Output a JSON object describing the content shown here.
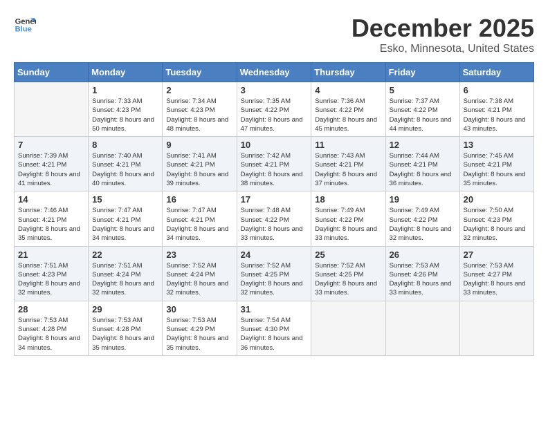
{
  "logo": {
    "line1": "General",
    "line2": "Blue"
  },
  "title": "December 2025",
  "location": "Esko, Minnesota, United States",
  "weekdays": [
    "Sunday",
    "Monday",
    "Tuesday",
    "Wednesday",
    "Thursday",
    "Friday",
    "Saturday"
  ],
  "weeks": [
    [
      {
        "day": "",
        "sunrise": "",
        "sunset": "",
        "daylight": ""
      },
      {
        "day": "1",
        "sunrise": "Sunrise: 7:33 AM",
        "sunset": "Sunset: 4:23 PM",
        "daylight": "Daylight: 8 hours and 50 minutes."
      },
      {
        "day": "2",
        "sunrise": "Sunrise: 7:34 AM",
        "sunset": "Sunset: 4:23 PM",
        "daylight": "Daylight: 8 hours and 48 minutes."
      },
      {
        "day": "3",
        "sunrise": "Sunrise: 7:35 AM",
        "sunset": "Sunset: 4:22 PM",
        "daylight": "Daylight: 8 hours and 47 minutes."
      },
      {
        "day": "4",
        "sunrise": "Sunrise: 7:36 AM",
        "sunset": "Sunset: 4:22 PM",
        "daylight": "Daylight: 8 hours and 45 minutes."
      },
      {
        "day": "5",
        "sunrise": "Sunrise: 7:37 AM",
        "sunset": "Sunset: 4:22 PM",
        "daylight": "Daylight: 8 hours and 44 minutes."
      },
      {
        "day": "6",
        "sunrise": "Sunrise: 7:38 AM",
        "sunset": "Sunset: 4:21 PM",
        "daylight": "Daylight: 8 hours and 43 minutes."
      }
    ],
    [
      {
        "day": "7",
        "sunrise": "Sunrise: 7:39 AM",
        "sunset": "Sunset: 4:21 PM",
        "daylight": "Daylight: 8 hours and 41 minutes."
      },
      {
        "day": "8",
        "sunrise": "Sunrise: 7:40 AM",
        "sunset": "Sunset: 4:21 PM",
        "daylight": "Daylight: 8 hours and 40 minutes."
      },
      {
        "day": "9",
        "sunrise": "Sunrise: 7:41 AM",
        "sunset": "Sunset: 4:21 PM",
        "daylight": "Daylight: 8 hours and 39 minutes."
      },
      {
        "day": "10",
        "sunrise": "Sunrise: 7:42 AM",
        "sunset": "Sunset: 4:21 PM",
        "daylight": "Daylight: 8 hours and 38 minutes."
      },
      {
        "day": "11",
        "sunrise": "Sunrise: 7:43 AM",
        "sunset": "Sunset: 4:21 PM",
        "daylight": "Daylight: 8 hours and 37 minutes."
      },
      {
        "day": "12",
        "sunrise": "Sunrise: 7:44 AM",
        "sunset": "Sunset: 4:21 PM",
        "daylight": "Daylight: 8 hours and 36 minutes."
      },
      {
        "day": "13",
        "sunrise": "Sunrise: 7:45 AM",
        "sunset": "Sunset: 4:21 PM",
        "daylight": "Daylight: 8 hours and 35 minutes."
      }
    ],
    [
      {
        "day": "14",
        "sunrise": "Sunrise: 7:46 AM",
        "sunset": "Sunset: 4:21 PM",
        "daylight": "Daylight: 8 hours and 35 minutes."
      },
      {
        "day": "15",
        "sunrise": "Sunrise: 7:47 AM",
        "sunset": "Sunset: 4:21 PM",
        "daylight": "Daylight: 8 hours and 34 minutes."
      },
      {
        "day": "16",
        "sunrise": "Sunrise: 7:47 AM",
        "sunset": "Sunset: 4:21 PM",
        "daylight": "Daylight: 8 hours and 34 minutes."
      },
      {
        "day": "17",
        "sunrise": "Sunrise: 7:48 AM",
        "sunset": "Sunset: 4:22 PM",
        "daylight": "Daylight: 8 hours and 33 minutes."
      },
      {
        "day": "18",
        "sunrise": "Sunrise: 7:49 AM",
        "sunset": "Sunset: 4:22 PM",
        "daylight": "Daylight: 8 hours and 33 minutes."
      },
      {
        "day": "19",
        "sunrise": "Sunrise: 7:49 AM",
        "sunset": "Sunset: 4:22 PM",
        "daylight": "Daylight: 8 hours and 32 minutes."
      },
      {
        "day": "20",
        "sunrise": "Sunrise: 7:50 AM",
        "sunset": "Sunset: 4:23 PM",
        "daylight": "Daylight: 8 hours and 32 minutes."
      }
    ],
    [
      {
        "day": "21",
        "sunrise": "Sunrise: 7:51 AM",
        "sunset": "Sunset: 4:23 PM",
        "daylight": "Daylight: 8 hours and 32 minutes."
      },
      {
        "day": "22",
        "sunrise": "Sunrise: 7:51 AM",
        "sunset": "Sunset: 4:24 PM",
        "daylight": "Daylight: 8 hours and 32 minutes."
      },
      {
        "day": "23",
        "sunrise": "Sunrise: 7:52 AM",
        "sunset": "Sunset: 4:24 PM",
        "daylight": "Daylight: 8 hours and 32 minutes."
      },
      {
        "day": "24",
        "sunrise": "Sunrise: 7:52 AM",
        "sunset": "Sunset: 4:25 PM",
        "daylight": "Daylight: 8 hours and 32 minutes."
      },
      {
        "day": "25",
        "sunrise": "Sunrise: 7:52 AM",
        "sunset": "Sunset: 4:25 PM",
        "daylight": "Daylight: 8 hours and 33 minutes."
      },
      {
        "day": "26",
        "sunrise": "Sunrise: 7:53 AM",
        "sunset": "Sunset: 4:26 PM",
        "daylight": "Daylight: 8 hours and 33 minutes."
      },
      {
        "day": "27",
        "sunrise": "Sunrise: 7:53 AM",
        "sunset": "Sunset: 4:27 PM",
        "daylight": "Daylight: 8 hours and 33 minutes."
      }
    ],
    [
      {
        "day": "28",
        "sunrise": "Sunrise: 7:53 AM",
        "sunset": "Sunset: 4:28 PM",
        "daylight": "Daylight: 8 hours and 34 minutes."
      },
      {
        "day": "29",
        "sunrise": "Sunrise: 7:53 AM",
        "sunset": "Sunset: 4:28 PM",
        "daylight": "Daylight: 8 hours and 35 minutes."
      },
      {
        "day": "30",
        "sunrise": "Sunrise: 7:53 AM",
        "sunset": "Sunset: 4:29 PM",
        "daylight": "Daylight: 8 hours and 35 minutes."
      },
      {
        "day": "31",
        "sunrise": "Sunrise: 7:54 AM",
        "sunset": "Sunset: 4:30 PM",
        "daylight": "Daylight: 8 hours and 36 minutes."
      },
      {
        "day": "",
        "sunrise": "",
        "sunset": "",
        "daylight": ""
      },
      {
        "day": "",
        "sunrise": "",
        "sunset": "",
        "daylight": ""
      },
      {
        "day": "",
        "sunrise": "",
        "sunset": "",
        "daylight": ""
      }
    ]
  ]
}
